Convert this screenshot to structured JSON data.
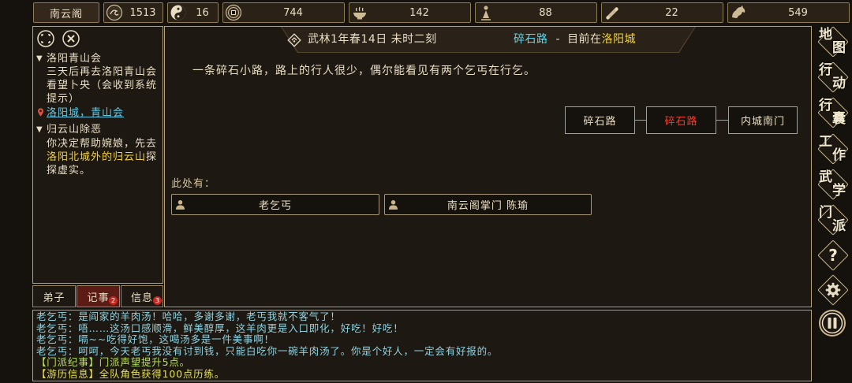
{
  "colors": {
    "background": "#15110c",
    "panel_border": "#b3a27f",
    "text": "#e9dec4",
    "location_cyan": "#5fd6e8",
    "highlight_yellow": "#f2d13c",
    "current_node_red": "#e8412f",
    "tab_selected": "#5b1c16",
    "badge_red": "#c8281e",
    "log_dialog": "#8fd4e2",
    "log_sect": "#b9e35a",
    "log_travel": "#e3e04e"
  },
  "top_bar": {
    "sect_name": "南云阁",
    "stats": [
      {
        "icon": "reputation-icon",
        "value": "1513"
      },
      {
        "icon": "yin-yang-icon",
        "value": "16"
      },
      {
        "icon": "coin-icon",
        "value": "744"
      },
      {
        "icon": "food-bowl-icon",
        "value": "142"
      },
      {
        "icon": "figure-icon",
        "value": "88"
      },
      {
        "icon": "scroll-icon",
        "value": "22"
      },
      {
        "icon": "beast-icon",
        "value": "549"
      }
    ]
  },
  "quest_panel": {
    "icons": [
      "focus-icon",
      "close-icon"
    ],
    "quests": [
      {
        "toggle": "▼",
        "title": "洛阳青山会",
        "desc_lines": [
          "三天后再去洛阳青山会",
          "看望卜央（会收到系统",
          "提示）"
        ],
        "location_icon": "location-pin-icon",
        "location": "洛阳城，青山会"
      },
      {
        "toggle": "▼",
        "title": "归云山除恶",
        "desc_line_1": "你决定帮助婉娘，先去",
        "desc_line_2_highlight": "洛阳北城外的归云山",
        "desc_line_2_rest": "探",
        "desc_line_3": "探虚实。"
      }
    ]
  },
  "bottom_tabs": [
    {
      "label": "弟子",
      "selected": false
    },
    {
      "label": "记事",
      "badge": "2",
      "selected": true
    },
    {
      "label": "信息",
      "badge": "3",
      "selected": false
    }
  ],
  "scene": {
    "header": {
      "icon": "compass-diamond-icon",
      "date": "武林1年春14日 未时二刻",
      "location": "碎石路",
      "separator": "-",
      "current_prefix": "目前在",
      "city": "洛阳城"
    },
    "description": "一条碎石小路，路上的行人很少，偶尔能看见有两个乞丐在行乞。",
    "map_nodes": [
      {
        "label": "碎石路",
        "current": false
      },
      {
        "label": "碎石路",
        "current": true
      },
      {
        "label": "内城南门",
        "current": false
      }
    ],
    "present_label": "此处有：",
    "npcs": [
      {
        "icon": "person-icon",
        "name": "老乞丐"
      },
      {
        "icon": "person-icon",
        "name": "南云阁掌门 陈瑜"
      }
    ]
  },
  "side_menu": [
    {
      "chars": [
        "地",
        "图"
      ]
    },
    {
      "chars": [
        "行",
        "动"
      ]
    },
    {
      "chars": [
        "行",
        "囊"
      ]
    },
    {
      "chars": [
        "工",
        "作"
      ]
    },
    {
      "chars": [
        "武",
        "学"
      ]
    },
    {
      "chars": [
        "门",
        "派"
      ]
    }
  ],
  "side_tools": {
    "help": "?",
    "settings_icon": "gear-icon",
    "pause_icon": "pause-icon"
  },
  "log": [
    {
      "type": "dialog",
      "text": "老乞丐：是阎家的羊肉汤！哈哈，多谢多谢，老丐我就不客气了！"
    },
    {
      "type": "dialog",
      "text": "老乞丐：唔……这汤口感顺滑，鲜美醇厚，这羊肉更是入口即化，好吃！好吃！"
    },
    {
      "type": "dialog",
      "text": "老乞丐：嗝~~吃得好饱，这喝汤多是一件美事啊！"
    },
    {
      "type": "dialog",
      "text": "老乞丐：呵呵，今天老丐我没有讨到钱，只能白吃你一碗羊肉汤了。你是个好人，一定会有好报的。"
    },
    {
      "type": "sect",
      "text": "【门派纪事】门派声望提升5点。"
    },
    {
      "type": "travel",
      "text": "【游历信息】全队角色获得100点历练。"
    }
  ]
}
